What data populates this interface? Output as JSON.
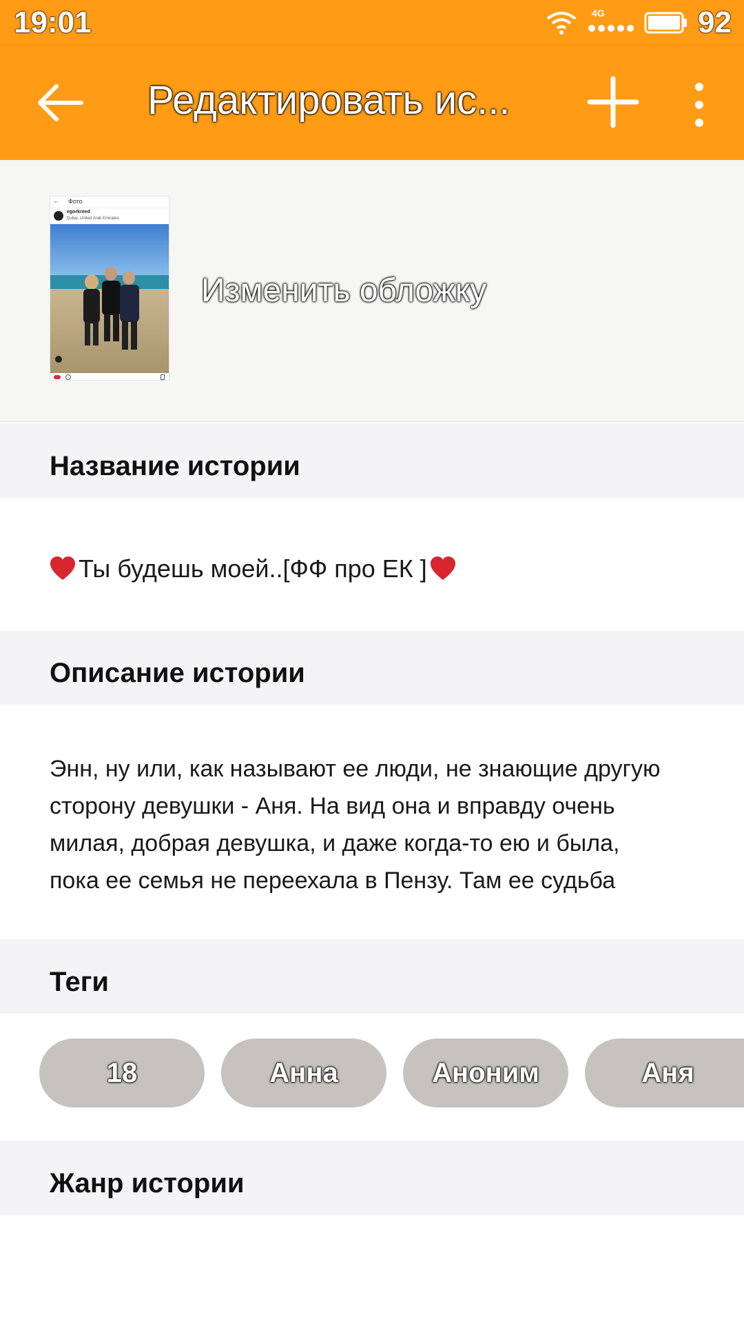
{
  "status_bar": {
    "time": "19:01",
    "network": "4G",
    "battery": "92"
  },
  "toolbar": {
    "title": "Редактировать ис...",
    "back_icon": "arrow-back-icon",
    "add_icon": "plus-icon",
    "more_icon": "more-vertical-icon"
  },
  "cover": {
    "change_label": "Изменить обложку",
    "thumb_screen_title": "Фото",
    "thumb_username": "egorkreed",
    "thumb_location": "Dubai, United Arab Emirates"
  },
  "story_name": {
    "header": "Название истории",
    "value": "Ты будешь моей..[ФФ про ЕК ]"
  },
  "story_description": {
    "header": "Описание истории",
    "lines": [
      "Энн, ну или, как называют ее люди, не знающие другую",
      "сторону девушки - Аня. На вид она и вправду очень",
      "милая, добрая девушка, и даже когда-то ею и была,",
      "пока ее семья не переехала в Пензу. Там ее судьба"
    ]
  },
  "tags": {
    "header": "Теги",
    "items": [
      "18",
      "Анна",
      "Аноним",
      "Аня"
    ]
  },
  "genre": {
    "header": "Жанр истории"
  },
  "colors": {
    "accent": "#ff9b15",
    "section_bg": "#f4f4f6",
    "tag_bg": "#c6c3bf"
  }
}
